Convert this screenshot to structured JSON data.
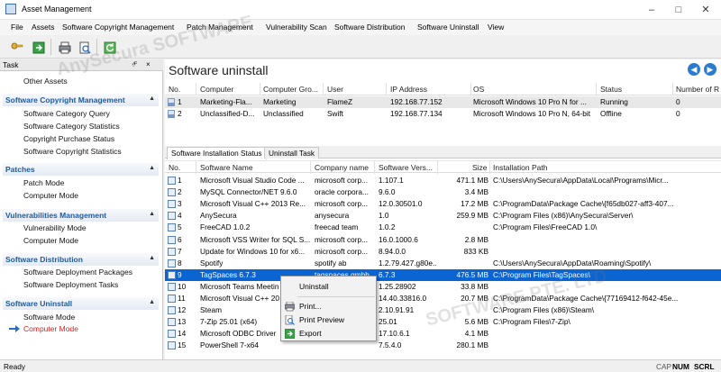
{
  "window": {
    "title": "Asset Management"
  },
  "menu": [
    "File",
    "Assets",
    "Software Copyright Management",
    "Patch Management",
    "Vulnerability Scan",
    "Software Distribution",
    "Software Uninstall",
    "View"
  ],
  "task_panel": {
    "title": "Task",
    "pin": "⮶",
    "close": "×",
    "top_item": "Other Assets",
    "groups": [
      {
        "label": "Software Copyright Management",
        "items": [
          "Software Category Query",
          "Software Category Statistics",
          "Copyright Purchase Status",
          "Software Copyright Statistics"
        ]
      },
      {
        "label": "Patches",
        "items": [
          "Patch Mode",
          "Computer Mode"
        ]
      },
      {
        "label": "Vulnerabilities Management",
        "items": [
          "Vulnerability Mode",
          "Computer Mode"
        ]
      },
      {
        "label": "Software Distribution",
        "items": [
          "Software Deployment Packages",
          "Software Deployment Tasks"
        ]
      },
      {
        "label": "Software Uninstall",
        "items": [
          "Software Mode",
          "Computer Mode"
        ]
      }
    ],
    "active_item": "Computer Mode"
  },
  "main": {
    "title": "Software uninstall",
    "computers": {
      "columns": [
        "No.",
        "Computer",
        "Computer Gro...",
        "User",
        "IP Address",
        "OS",
        "Status",
        "Number of R"
      ],
      "rows": [
        [
          "1",
          "Marketing-Fla...",
          "Marketing",
          "FlameZ",
          "192.168.77.152",
          "Microsoft Windows 10 Pro N for ...",
          "Running",
          "0"
        ],
        [
          "2",
          "Unclassified-D...",
          "Unclassified",
          "Swift",
          "192.168.77.134",
          "Microsoft Windows 10 Pro N, 64-bit",
          "Offline",
          "0"
        ]
      ]
    },
    "tabs": [
      "Software Installation Status",
      "Uninstall Task"
    ],
    "software": {
      "columns": [
        "No.",
        "Software Name",
        "Company name",
        "Software Vers...",
        "Size",
        "Installation Path"
      ],
      "rows": [
        [
          "1",
          "Microsoft Visual Studio Code ...",
          "microsoft corp...",
          "1.107.1",
          "471.1 MB",
          "C:\\Users\\AnySecura\\AppData\\Local\\Programs\\Micr..."
        ],
        [
          "2",
          "MySQL Connector/NET 9.6.0",
          "oracle corpora...",
          "9.6.0",
          "3.4 MB",
          ""
        ],
        [
          "3",
          "Microsoft Visual C++ 2013 Re...",
          "microsoft corp...",
          "12.0.30501.0",
          "17.2 MB",
          "C:\\ProgramData\\Package Cache\\{f65db027-aff3-407..."
        ],
        [
          "4",
          "AnySecura",
          "anysecura",
          "1.0",
          "259.9 MB",
          "C:\\Program Files (x86)\\AnySecura\\Server\\"
        ],
        [
          "5",
          "FreeCAD 1.0.2",
          "freecad team",
          "1.0.2",
          "",
          "C:\\Program Files\\FreeCAD 1.0\\"
        ],
        [
          "6",
          "Microsoft VSS Writer for SQL S...",
          "microsoft corp...",
          "16.0.1000.6",
          "2.8 MB",
          ""
        ],
        [
          "7",
          "Update for Windows 10 for x6...",
          "microsoft corp...",
          "8.94.0.0",
          "833 KB",
          ""
        ],
        [
          "8",
          "Spotify",
          "spotify ab",
          "1.2.79.427.g80e...",
          "",
          "C:\\Users\\AnySecura\\AppData\\Roaming\\Spotify\\"
        ],
        [
          "9",
          "TagSpaces 6.7.3",
          "tagspaces gmbh",
          "6.7.3",
          "476.5 MB",
          "C:\\Program Files\\TagSpaces\\"
        ],
        [
          "10",
          "Microsoft Teams Meetin",
          "",
          "1.25.28902",
          "33.8 MB",
          ""
        ],
        [
          "11",
          "Microsoft Visual C++ 20",
          "",
          "14.40.33816.0",
          "20.7 MB",
          "C:\\ProgramData\\Package Cache\\{77169412-f642-45e..."
        ],
        [
          "12",
          "Steam",
          "",
          "2.10.91.91",
          "",
          "C:\\Program Files (x86)\\Steam\\"
        ],
        [
          "13",
          "7-Zip 25.01 (x64)",
          "",
          "25.01",
          "5.6 MB",
          "C:\\Program Files\\7-Zip\\"
        ],
        [
          "14",
          "Microsoft ODBC Driver",
          "",
          "17.10.6.1",
          "4.1 MB",
          ""
        ],
        [
          "15",
          "PowerShell 7-x64",
          "",
          "7.5.4.0",
          "280.1 MB",
          ""
        ]
      ],
      "selected_index": 8
    }
  },
  "context_menu": [
    "Uninstall",
    "Print...",
    "Print Preview",
    "Export"
  ],
  "status_bar": {
    "left": "Ready",
    "indicators": [
      "CAP",
      "NUM",
      "SCRL"
    ]
  },
  "watermark": [
    "AnySecura SOFTWARE",
    "SOFTWARE PTE. LTD"
  ],
  "colors": {
    "accent": "#0a64d2",
    "group_label": "#1f5aa0",
    "active_item": "#d6221f"
  }
}
